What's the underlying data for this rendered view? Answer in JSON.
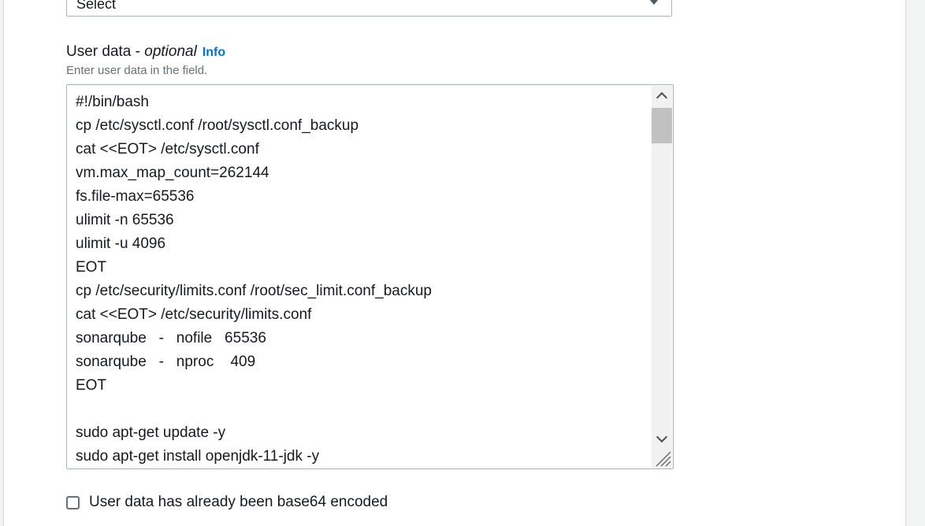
{
  "select": {
    "value": "Select"
  },
  "user_data": {
    "label": "User data - ",
    "label_optional": "optional",
    "info_link": "Info",
    "description": "Enter user data in the field.",
    "lines": [
      "#!/bin/bash",
      "cp /etc/sysctl.conf /root/sysctl.conf_backup",
      "cat <<EOT> /etc/sysctl.conf",
      "vm.max_map_count=262144",
      "fs.file-max=65536",
      "ulimit -n 65536",
      "ulimit -u 4096",
      "EOT",
      "cp /etc/security/limits.conf /root/sec_limit.conf_backup",
      "cat <<EOT> /etc/security/limits.conf",
      "sonarqube   -   nofile   65536",
      "sonarqube   -   nproc    409",
      "EOT",
      "",
      "sudo apt-get update -y",
      "sudo apt-get install openjdk-11-jdk -y"
    ]
  },
  "base64_checkbox": {
    "label": "User data has already been base64 encoded",
    "checked": false
  },
  "colors": {
    "link": "#0073bb",
    "border": "#aab7b8",
    "muted_text": "#687078"
  }
}
